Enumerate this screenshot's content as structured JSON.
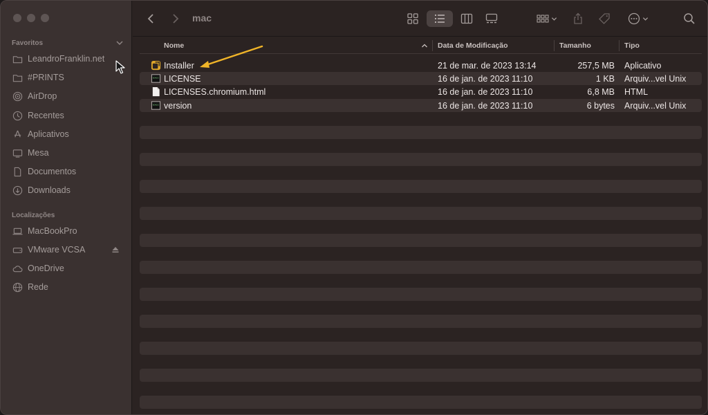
{
  "window": {
    "folder_title": "mac"
  },
  "sidebar": {
    "favorites_title": "Favoritos",
    "favorites": [
      {
        "label": "LeandroFranklin.net",
        "icon": "folder-icon"
      },
      {
        "label": "#PRINTS",
        "icon": "folder-icon"
      },
      {
        "label": "AirDrop",
        "icon": "airdrop-icon"
      },
      {
        "label": "Recentes",
        "icon": "clock-icon"
      },
      {
        "label": "Aplicativos",
        "icon": "apps-icon"
      },
      {
        "label": "Mesa",
        "icon": "desktop-icon"
      },
      {
        "label": "Documentos",
        "icon": "document-icon"
      },
      {
        "label": "Downloads",
        "icon": "download-icon"
      }
    ],
    "locations_title": "Localizações",
    "locations": [
      {
        "label": "MacBookPro",
        "icon": "laptop-icon"
      },
      {
        "label": "VMware VCSA",
        "icon": "disk-icon"
      },
      {
        "label": "OneDrive",
        "icon": "cloud-icon"
      },
      {
        "label": "Rede",
        "icon": "network-icon"
      }
    ]
  },
  "columns": {
    "name": "Nome",
    "date": "Data de Modificação",
    "size": "Tamanho",
    "kind": "Tipo"
  },
  "files": [
    {
      "name": "Installer",
      "date": "21 de mar. de 2023 13:14",
      "size": "257,5 MB",
      "kind": "Aplicativo",
      "icon": "installer-icon"
    },
    {
      "name": "LICENSE",
      "date": "16 de jan. de 2023 11:10",
      "size": "1 KB",
      "kind": "Arquiv...vel Unix",
      "icon": "terminal-file-icon"
    },
    {
      "name": "LICENSES.chromium.html",
      "date": "16 de jan. de 2023 11:10",
      "size": "6,8 MB",
      "kind": "HTML",
      "icon": "html-file-icon"
    },
    {
      "name": "version",
      "date": "16 de jan. de 2023 11:10",
      "size": "6 bytes",
      "kind": "Arquiv...vel Unix",
      "icon": "terminal-file-icon"
    }
  ],
  "colors": {
    "accent_arrow": "#f0b428",
    "window_bg": "#2b2322",
    "sidebar_bg": "#3a3130",
    "stripe": "#3a3130"
  }
}
